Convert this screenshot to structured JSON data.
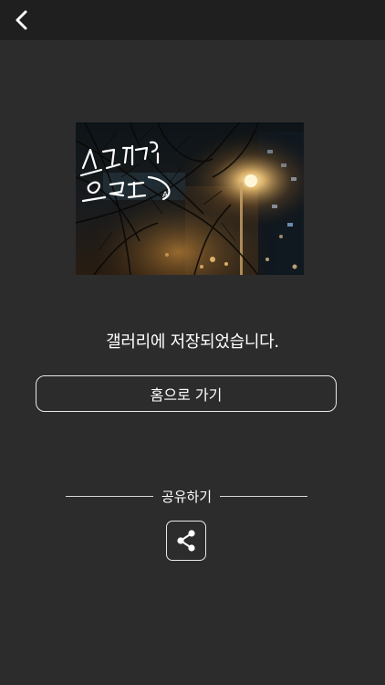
{
  "header": {
    "back_icon": "chevron-left-icon"
  },
  "photo": {
    "caption_text": "수고했어 오늘도"
  },
  "status": {
    "message": "갤러리에 저장되었습니다."
  },
  "actions": {
    "home_label": "홈으로 가기"
  },
  "share": {
    "label": "공유하기",
    "icon": "share-icon"
  },
  "colors": {
    "background": "#2c2c2c",
    "topbar": "#1f1f1f",
    "text": "#ffffff"
  }
}
